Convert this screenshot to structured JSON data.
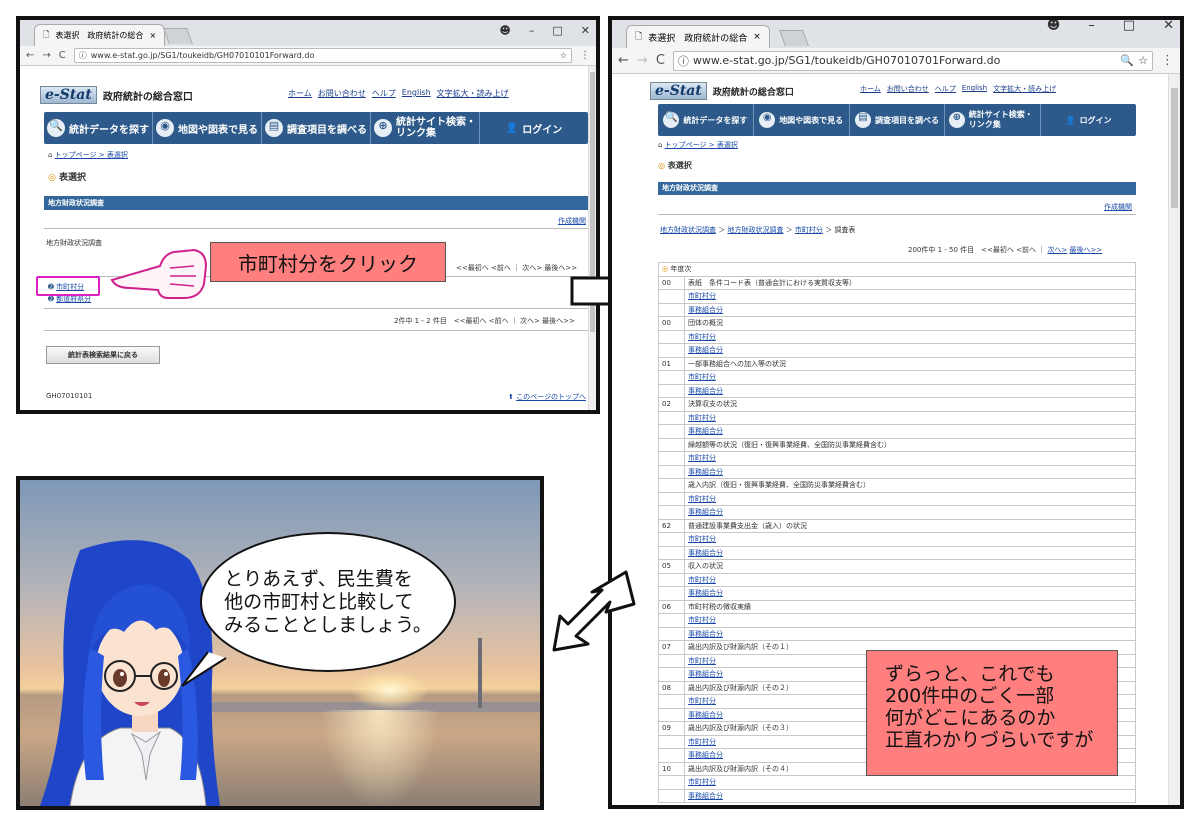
{
  "panel1": {
    "tab_title": "表選択　政府統計の総合",
    "url": "www.e-stat.go.jp/SG1/toukeidb/GH07010101Forward.do",
    "logo": "e-Stat",
    "site_name": "政府統計の総合窓口",
    "toplinks": [
      "ホーム",
      "お問い合わせ",
      "ヘルプ",
      "English",
      "文字拡大・読み上げ"
    ],
    "nav": [
      "統計データを探す",
      "地図や図表で見る",
      "調査項目を調べる",
      "統計サイト検索・リンク集",
      "ログイン"
    ],
    "breadcrumb": "トップページ > 表選択",
    "page_title": "表選択",
    "survey_bar": "地方財政状況調査",
    "creator_link": "作成機関",
    "survey_label": "地方財政状況調査",
    "pagination_top": "<<最初へ <前へ ｜ 次へ> 最後へ>>",
    "links": [
      "市町村分",
      "都道府県分"
    ],
    "pagination_bottom": "2件中 1 - 2 件目　<<最初へ <前へ ｜ 次へ> 最後へ>>",
    "back_button": "統計表検索結果に戻る",
    "page_id": "GH07010101",
    "to_top": "このページのトップへ",
    "callout": "市町村分をクリック"
  },
  "panel2": {
    "tab_title": "表選択　政府統計の総合",
    "url": "www.e-stat.go.jp/SG1/toukeidb/GH07010701Forward.do",
    "breadcrumb": "トップページ > 表選択",
    "page_title": "表選択",
    "survey_bar": "地方財政状況調査",
    "creator_link": "作成機関",
    "path": [
      "地方財政状況調査",
      "地方財政状況調査",
      "市町村分",
      "調査表"
    ],
    "pagination": "200件中 1 - 50 件目　<<最初へ <前へ ｜",
    "pagination_links": [
      "次へ>",
      "最後へ>>"
    ],
    "year_header": "年度次",
    "rows": [
      {
        "num": "00",
        "text": "表紙　条件コード表（普通会計における実質収支等）"
      },
      {
        "num": "",
        "text": "市町村分",
        "link": true
      },
      {
        "num": "",
        "text": "事務組合分",
        "link": true
      },
      {
        "num": "00",
        "text": "団体の概況"
      },
      {
        "num": "",
        "text": "市町村分",
        "link": true
      },
      {
        "num": "",
        "text": "事務組合分",
        "link": true
      },
      {
        "num": "01",
        "text": "一部事務組合への加入等の状況"
      },
      {
        "num": "",
        "text": "市町村分",
        "link": true
      },
      {
        "num": "",
        "text": "事務組合分",
        "link": true
      },
      {
        "num": "02",
        "text": "決算収支の状況"
      },
      {
        "num": "",
        "text": "市町村分",
        "link": true
      },
      {
        "num": "",
        "text": "事務組合分",
        "link": true
      },
      {
        "num": "",
        "text": "繰越額等の状況（復旧・復興事業経費、全国防災事業経費含む）"
      },
      {
        "num": "",
        "text": "市町村分",
        "link": true
      },
      {
        "num": "",
        "text": "事務組合分",
        "link": true
      },
      {
        "num": "",
        "text": "歳入内訳（復旧・復興事業経費、全国防災事業経費含む）"
      },
      {
        "num": "",
        "text": "市町村分",
        "link": true
      },
      {
        "num": "",
        "text": "事務組合分",
        "link": true
      },
      {
        "num": "62",
        "text": "普通建設事業費支出金（歳入）の状況"
      },
      {
        "num": "",
        "text": "市町村分",
        "link": true
      },
      {
        "num": "",
        "text": "事務組合分",
        "link": true
      },
      {
        "num": "05",
        "text": "収入の状況"
      },
      {
        "num": "",
        "text": "市町村分",
        "link": true
      },
      {
        "num": "",
        "text": "事務組合分",
        "link": true
      },
      {
        "num": "06",
        "text": "市町村税の徴収実績"
      },
      {
        "num": "",
        "text": "市町村分",
        "link": true
      },
      {
        "num": "",
        "text": "事務組合分",
        "link": true
      },
      {
        "num": "07",
        "text": "歳出内訳及び財源内訳（その１）"
      },
      {
        "num": "",
        "text": "市町村分",
        "link": true
      },
      {
        "num": "",
        "text": "事務組合分",
        "link": true
      },
      {
        "num": "08",
        "text": "歳出内訳及び財源内訳（その２）"
      },
      {
        "num": "",
        "text": "市町村分",
        "link": true
      },
      {
        "num": "",
        "text": "事務組合分",
        "link": true
      },
      {
        "num": "09",
        "text": "歳出内訳及び財源内訳（その３）"
      },
      {
        "num": "",
        "text": "市町村分",
        "link": true
      },
      {
        "num": "",
        "text": "事務組合分",
        "link": true
      },
      {
        "num": "10",
        "text": "歳出内訳及び財源内訳（その４）"
      },
      {
        "num": "",
        "text": "市町村分",
        "link": true
      },
      {
        "num": "",
        "text": "事務組合分",
        "link": true
      }
    ],
    "callout": [
      "ずらっと、これでも",
      "200件中のごく一部",
      "何がどこにあるのか",
      "正直わかりづらいですが"
    ]
  },
  "panel3": {
    "speech": [
      "とりあえず、民生費を",
      "他の市町村と比較して",
      "みることとしましょう。"
    ]
  }
}
